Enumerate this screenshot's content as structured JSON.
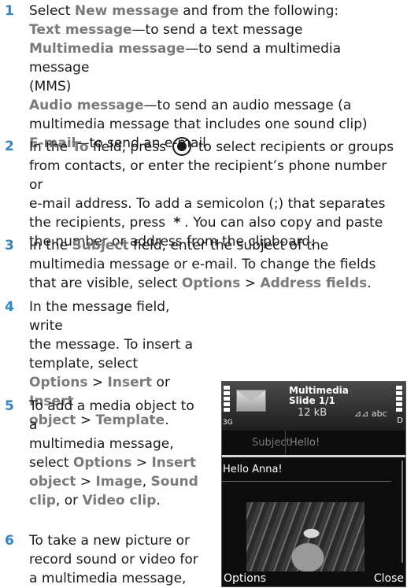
{
  "step1": {
    "num": "1",
    "intro_a": "Select ",
    "new_message": "New message",
    "intro_b": " and from the following:",
    "text_message": "Text message",
    "text_message_desc": "—to send a text message",
    "multimedia_message": "Multimedia message",
    "multimedia_message_desc_a": "—to send a multimedia message",
    "multimedia_message_desc_b": "(MMS)",
    "audio_message": "Audio message",
    "audio_message_desc_a": "—to send an audio message (a",
    "audio_message_desc_b": "multimedia message that includes one sound clip)",
    "email": "E-mail",
    "email_desc": "—to send an e-mail"
  },
  "step2": {
    "num": "2",
    "a": "In the ",
    "to": "To",
    "b": " field, press ",
    "c": " to select recipients or groups",
    "l2": "from contacts, or enter the recipient’s phone number or",
    "l3": "e-mail address. To add a semicolon (;) that separates",
    "l4a": "the recipients, press ",
    "star": "*",
    "l4b": ". You can also copy and paste",
    "l5": "the number or address from the clipboard."
  },
  "step3": {
    "num": "3",
    "a": "In the ",
    "subject": "Subject",
    "b": " field, enter the subject of the",
    "l2": "multimedia message or e-mail. To change the fields",
    "l3a": "that are visible, select ",
    "options": "Options",
    "gt": " > ",
    "address_fields": "Address fields",
    "dot": "."
  },
  "step4": {
    "num": "4",
    "l1": "In the message field, write",
    "l2": "the message. To insert a",
    "l3": "template, select",
    "options": "Options",
    "gt": " > ",
    "insert": "Insert",
    "or": " or ",
    "insert_object_a": "Insert",
    "insert_object_b": "object",
    "template": "Template",
    "dot": "."
  },
  "step5": {
    "num": "5",
    "l1": "To add a media object to a",
    "l2": "multimedia message,",
    "l3a": "select ",
    "options": "Options",
    "gt": " > ",
    "insert": "Insert",
    "object": "object",
    "image": "Image",
    "comma": ", ",
    "sound": "Sound",
    "clip": "clip",
    "or": ", or ",
    "video_clip": "Video clip",
    "dot": "."
  },
  "step6": {
    "num": "6",
    "l1": "To take a new picture or",
    "l2": "record sound or video for",
    "l3": "a multimedia message,"
  },
  "phone": {
    "title": "Multimedia",
    "slide": "Slide 1/1",
    "size": "12 kB",
    "indicator": "⊿⊿ abc",
    "network": "3G",
    "subject_label": "Subject",
    "subject_value": "Hello!",
    "body_text": "Hello Anna!",
    "left_softkey": "Options",
    "right_softkey": "Close"
  }
}
